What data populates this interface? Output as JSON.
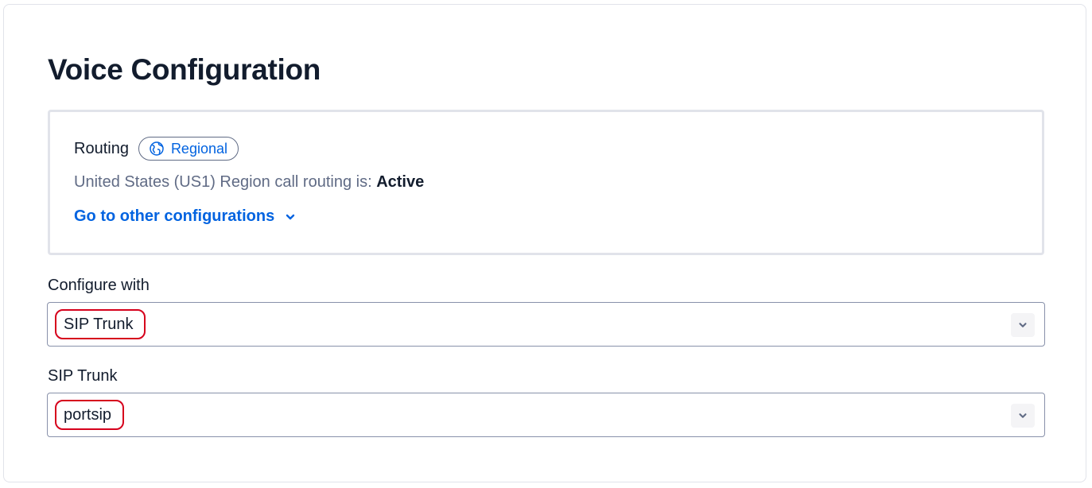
{
  "page": {
    "title": "Voice Configuration"
  },
  "routing": {
    "label": "Routing",
    "badge_label": "Regional",
    "badge_icon": "globe-icon",
    "status_prefix": "United States (US1) Region call routing is: ",
    "status_value": "Active",
    "other_configs_link": "Go to other configurations",
    "other_configs_icon": "chevron-down-icon"
  },
  "configure_with": {
    "label": "Configure with",
    "selected": "SIP Trunk"
  },
  "sip_trunk": {
    "label": "SIP Trunk",
    "selected": "portsip"
  },
  "colors": {
    "link": "#0263e0",
    "text": "#121c2d",
    "muted": "#606b85",
    "highlight": "#d6001c",
    "border": "#e1e3ea"
  }
}
